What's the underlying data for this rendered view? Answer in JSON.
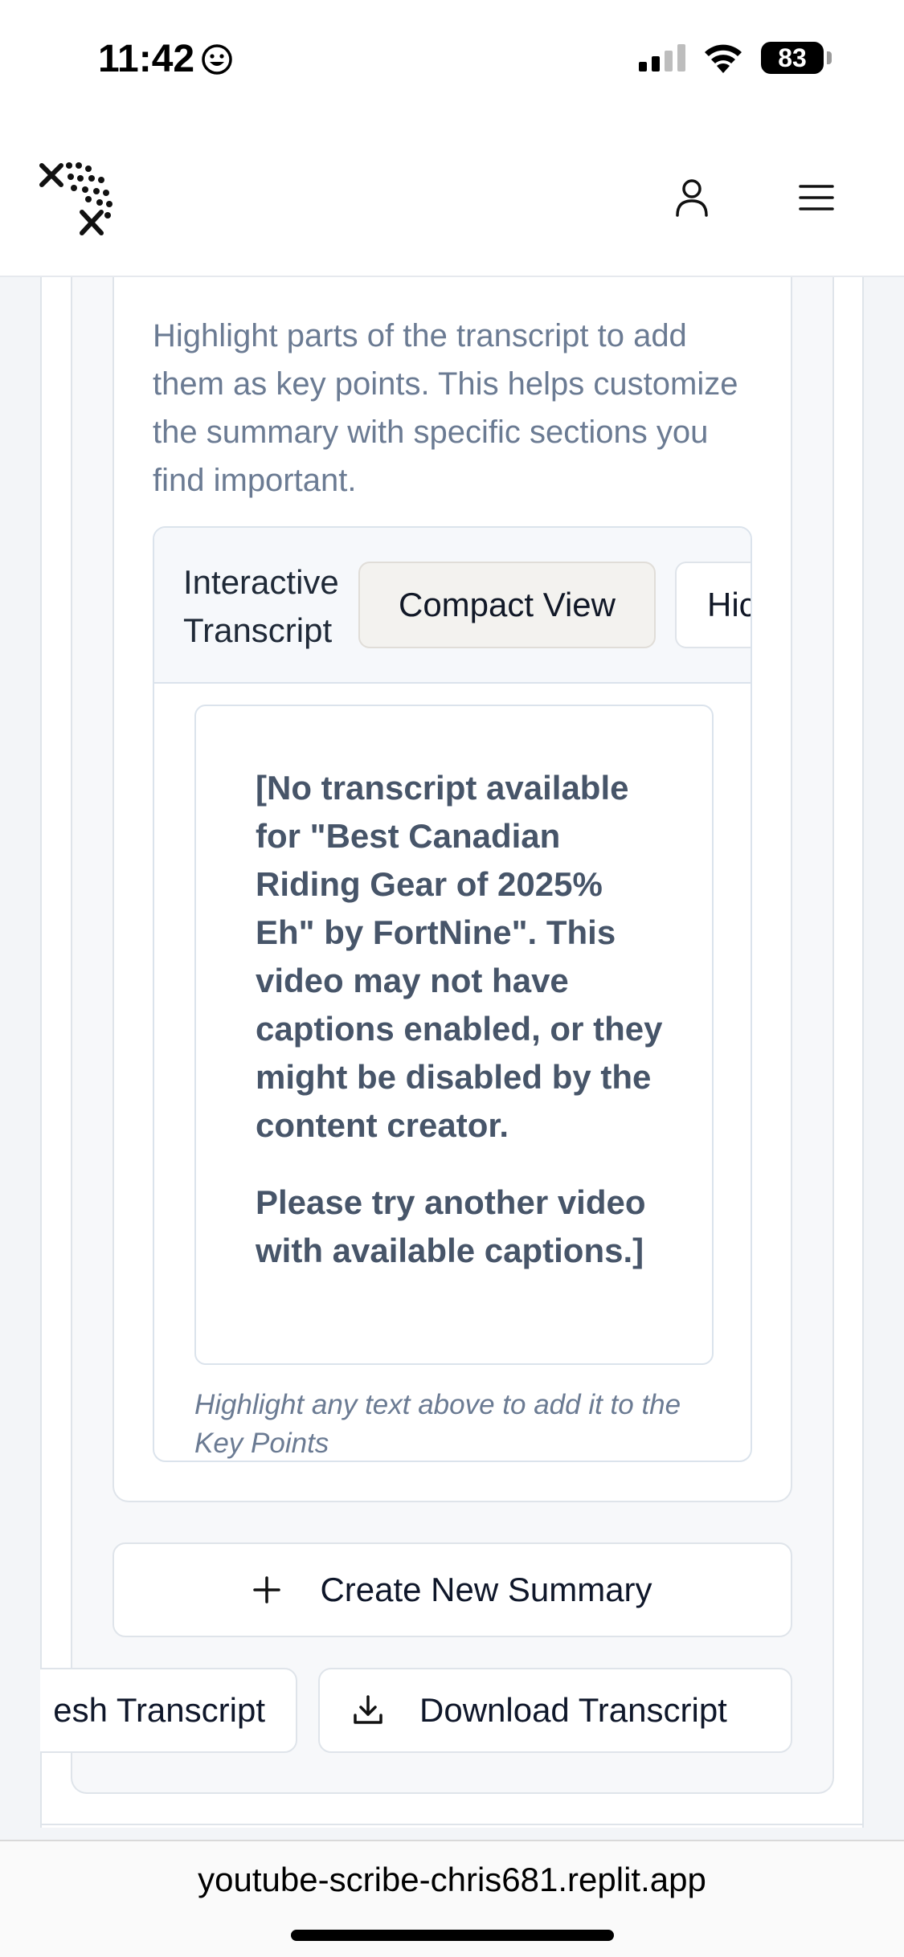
{
  "status_bar": {
    "time": "11:42",
    "battery": "83"
  },
  "header": {
    "logo_icon": "dotted-x-logo",
    "user_icon": "user-icon",
    "menu_icon": "hamburger-menu-icon"
  },
  "instructions": "Highlight parts of the transcript to add them as key points. This helps customize the summary with specific sections you find important.",
  "transcript_panel": {
    "title": "Interactive Transcript",
    "compact_view_label": "Compact View",
    "hide_label": "Hic",
    "paragraphs": [
      "[No transcript available for \"Best Canadian Riding Gear of 2025% Eh\" by FortNine\". This video may not have captions enabled, or they might be disabled by the content creator.",
      "Please try another video with available captions.]"
    ],
    "hint": "Highlight any text above to add it to the Key Points"
  },
  "actions": {
    "create_summary_label": "Create New Summary",
    "refresh_transcript_label": "esh Transcript",
    "download_transcript_label": "Download Transcript"
  },
  "browser": {
    "url": "youtube-scribe-chris681.replit.app"
  },
  "colors": {
    "muted_text": "#6b7b93",
    "border": "#dfe4ea",
    "page_bg": "#f3f5f8"
  }
}
